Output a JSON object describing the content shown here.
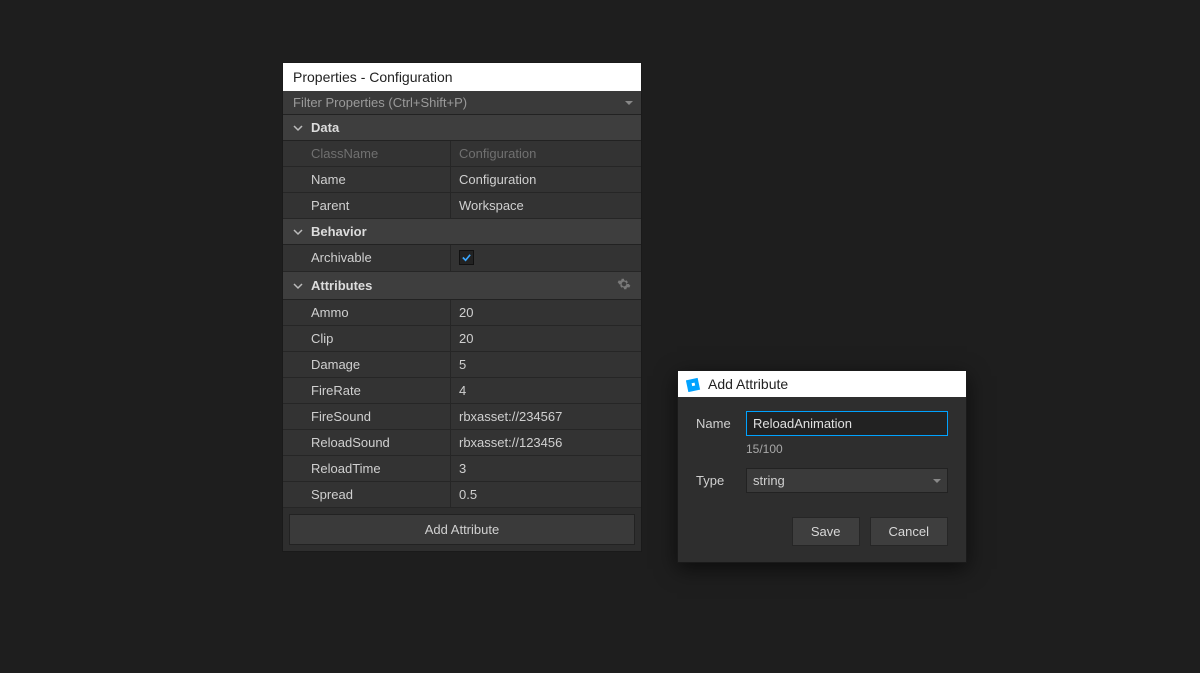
{
  "panel": {
    "title": "Properties - Configuration",
    "filter_placeholder": "Filter Properties (Ctrl+Shift+P)"
  },
  "sections": {
    "data": {
      "label": "Data",
      "rows": [
        {
          "name": "ClassName",
          "value": "Configuration",
          "readonly": true
        },
        {
          "name": "Name",
          "value": "Configuration"
        },
        {
          "name": "Parent",
          "value": "Workspace"
        }
      ]
    },
    "behavior": {
      "label": "Behavior",
      "rows": [
        {
          "name": "Archivable",
          "value": true,
          "type": "checkbox"
        }
      ]
    },
    "attributes": {
      "label": "Attributes",
      "rows": [
        {
          "name": "Ammo",
          "value": "20"
        },
        {
          "name": "Clip",
          "value": "20"
        },
        {
          "name": "Damage",
          "value": "5"
        },
        {
          "name": "FireRate",
          "value": "4"
        },
        {
          "name": "FireSound",
          "value": "rbxasset://234567"
        },
        {
          "name": "ReloadSound",
          "value": "rbxasset://123456"
        },
        {
          "name": "ReloadTime",
          "value": "3"
        },
        {
          "name": "Spread",
          "value": "0.5"
        }
      ],
      "add_button": "Add Attribute"
    }
  },
  "modal": {
    "title": "Add Attribute",
    "name_label": "Name",
    "name_value": "ReloadAnimation",
    "counter": "15/100",
    "type_label": "Type",
    "type_value": "string",
    "save": "Save",
    "cancel": "Cancel"
  }
}
